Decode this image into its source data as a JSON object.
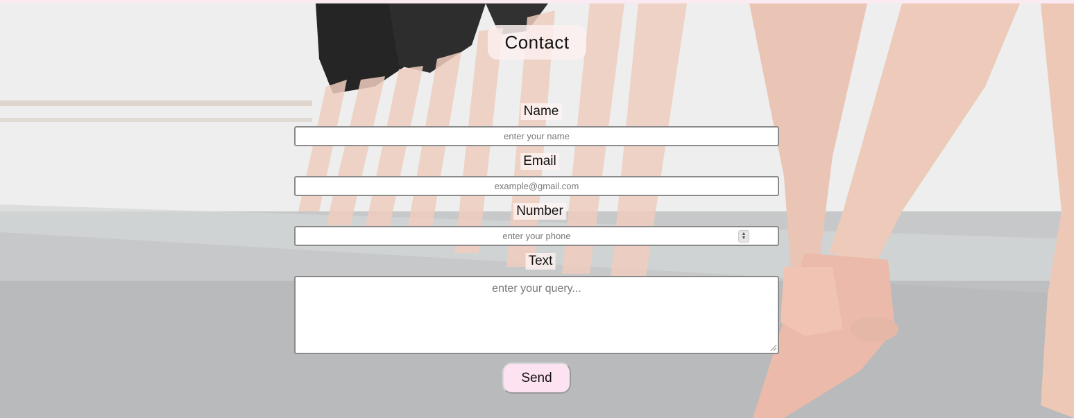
{
  "page": {
    "title": "Contact",
    "background_icon": "ballet-dancers-photo"
  },
  "form": {
    "fields": [
      {
        "label": "Name",
        "placeholder": "enter your name",
        "type": "text"
      },
      {
        "label": "Email",
        "placeholder": "example@gmail.com",
        "type": "email"
      },
      {
        "label": "Number",
        "placeholder": "enter your phone",
        "type": "number"
      },
      {
        "label": "Text",
        "placeholder": "enter your query...",
        "type": "textarea"
      }
    ],
    "submit_label": "Send"
  },
  "colors": {
    "button_bg": "#fde3f1",
    "title_bg": "#fcf0ee",
    "border": "#8a8a8a"
  }
}
